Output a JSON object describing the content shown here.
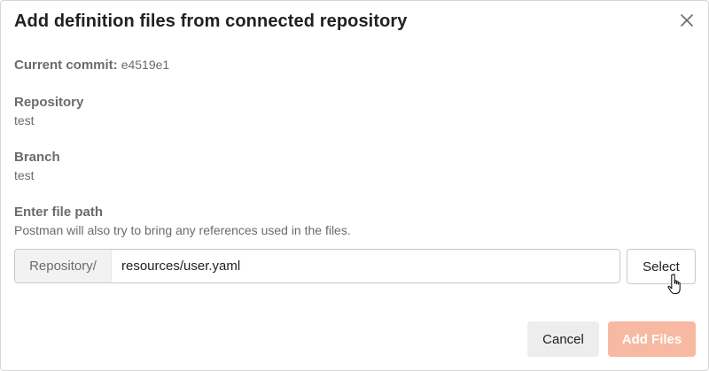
{
  "dialog": {
    "title": "Add definition files from connected repository",
    "close_icon": "close-icon"
  },
  "commit": {
    "label": "Current commit:",
    "value": "e4519e1"
  },
  "repository": {
    "label": "Repository",
    "value": "test"
  },
  "branch": {
    "label": "Branch",
    "value": "test"
  },
  "file_path": {
    "label": "Enter file path",
    "helper": "Postman will also try to bring any references used in the files.",
    "prefix": "Repository/",
    "value": "resources/user.yaml",
    "select_label": "Select"
  },
  "footer": {
    "cancel_label": "Cancel",
    "add_label": "Add Files"
  },
  "colors": {
    "primary_disabled": "#f7b9a2",
    "secondary_bg": "#ededed",
    "text_muted": "#6b6b6b"
  },
  "icons": {
    "close": "close-icon",
    "cursor": "hand-pointer-icon"
  }
}
